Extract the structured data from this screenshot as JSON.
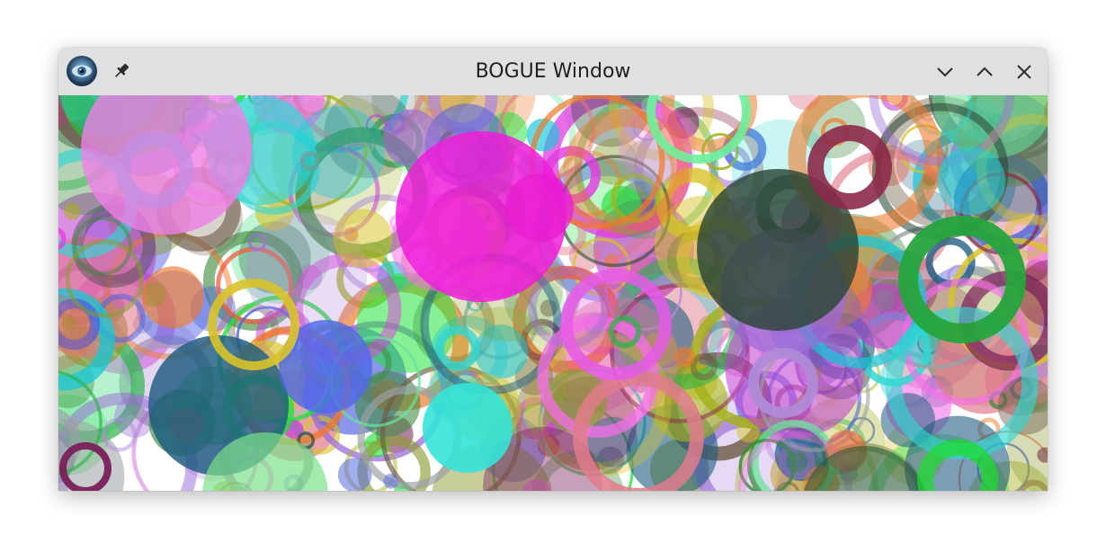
{
  "window": {
    "title": "BOGUE Window"
  },
  "titlebar": {
    "app_icon": "bogue-eye-icon",
    "pin_icon": "pin-icon",
    "minimize_icon": "chevron-down-icon",
    "maximize_icon": "chevron-up-icon",
    "close_icon": "close-icon"
  },
  "canvas": {
    "background": "#ffffff",
    "palette": [
      "#e23ce0",
      "#f66de8",
      "#c23fd1",
      "#3d8b3d",
      "#2bb34a",
      "#1ee33a",
      "#30d7d2",
      "#19c6d6",
      "#4f63e0",
      "#1d5c80",
      "#8c9a2f",
      "#a5b21d",
      "#d8c32a",
      "#ee7a2c",
      "#ef5b3c",
      "#e0778a",
      "#8c2a4a",
      "#7a1f5a",
      "#9b6bd6",
      "#b08ad8",
      "#68e39a",
      "#9aa0a4",
      "#6e5c48",
      "#2e4a3a"
    ]
  }
}
